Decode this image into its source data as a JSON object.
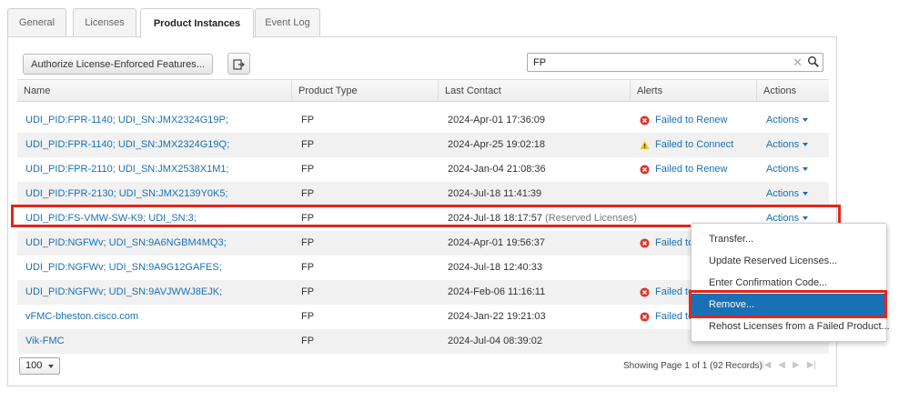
{
  "tabs": [
    {
      "label": "General"
    },
    {
      "label": "Licenses"
    },
    {
      "label": "Product Instances",
      "active": true
    },
    {
      "label": "Event Log"
    }
  ],
  "toolbar": {
    "authorize_label": "Authorize License-Enforced Features...",
    "export_icon": "export-icon"
  },
  "search": {
    "value": "FP",
    "clear_glyph": "✕",
    "icon": "search-icon"
  },
  "table": {
    "columns": [
      "Name",
      "Product Type",
      "Last Contact",
      "Alerts",
      "Actions"
    ],
    "rows": [
      {
        "name": "UDI_PID:FPR-1140; UDI_SN:JMX2324G19P;",
        "type": "FP",
        "contact": "2024-Apr-01 17:36:09",
        "reserved": "",
        "alert": "Failed to Renew",
        "alert_kind": "error",
        "actions": "Actions"
      },
      {
        "name": "UDI_PID:FPR-1140; UDI_SN:JMX2324G19Q;",
        "type": "FP",
        "contact": "2024-Apr-25 19:02:18",
        "reserved": "",
        "alert": "Failed to Connect",
        "alert_kind": "warning",
        "actions": "Actions"
      },
      {
        "name": "UDI_PID:FPR-2110; UDI_SN:JMX2538X1M1;",
        "type": "FP",
        "contact": "2024-Jan-04 21:08:36",
        "reserved": "",
        "alert": "Failed to Renew",
        "alert_kind": "error",
        "actions": "Actions"
      },
      {
        "name": "UDI_PID:FPR-2130; UDI_SN:JMX2139Y0K5;",
        "type": "FP",
        "contact": "2024-Jul-18 11:41:39",
        "reserved": "",
        "alert": "",
        "alert_kind": "",
        "actions": "Actions"
      },
      {
        "name": "UDI_PID:FS-VMW-SW-K9; UDI_SN:3;",
        "type": "FP",
        "contact": "2024-Jul-18 18:17:57",
        "reserved": "(Reserved Licenses)",
        "alert": "",
        "alert_kind": "",
        "actions": "Actions"
      },
      {
        "name": "UDI_PID:NGFWv; UDI_SN:9A6NGBM4MQ3;",
        "type": "FP",
        "contact": "2024-Apr-01 19:56:37",
        "reserved": "",
        "alert": "Failed to",
        "alert_kind": "error",
        "actions": ""
      },
      {
        "name": "UDI_PID:NGFWv; UDI_SN:9A9G12GAFES;",
        "type": "FP",
        "contact": "2024-Jul-18 12:40:33",
        "reserved": "",
        "alert": "",
        "alert_kind": "",
        "actions": ""
      },
      {
        "name": "UDI_PID:NGFWv; UDI_SN:9AVJWWJ8EJK;",
        "type": "FP",
        "contact": "2024-Feb-06 11:16:11",
        "reserved": "",
        "alert": "Failed to",
        "alert_kind": "error",
        "actions": ""
      },
      {
        "name": "vFMC-bheston.cisco.com",
        "type": "FP",
        "contact": "2024-Jan-22 19:21:03",
        "reserved": "",
        "alert": "Failed to",
        "alert_kind": "error",
        "actions": ""
      },
      {
        "name": "Vik-FMC",
        "type": "FP",
        "contact": "2024-Jul-04 08:39:02",
        "reserved": "",
        "alert": "",
        "alert_kind": "",
        "actions": ""
      }
    ]
  },
  "actions_menu": {
    "items": [
      {
        "label": "Transfer..."
      },
      {
        "label": "Update Reserved Licenses..."
      },
      {
        "label": "Enter Confirmation Code..."
      },
      {
        "label": "Remove...",
        "selected": true
      },
      {
        "label": "Rehost Licenses from a Failed Product..."
      }
    ]
  },
  "footer": {
    "page_size": "100",
    "showing": "Showing Page 1 of 1 (92 Records)",
    "pager": [
      "|◀",
      "◀",
      "▶",
      "▶|"
    ]
  },
  "colors": {
    "link": "#1a70b5",
    "highlight": "#e3261b",
    "error": "#d9342b",
    "warning": "#f2c318"
  }
}
